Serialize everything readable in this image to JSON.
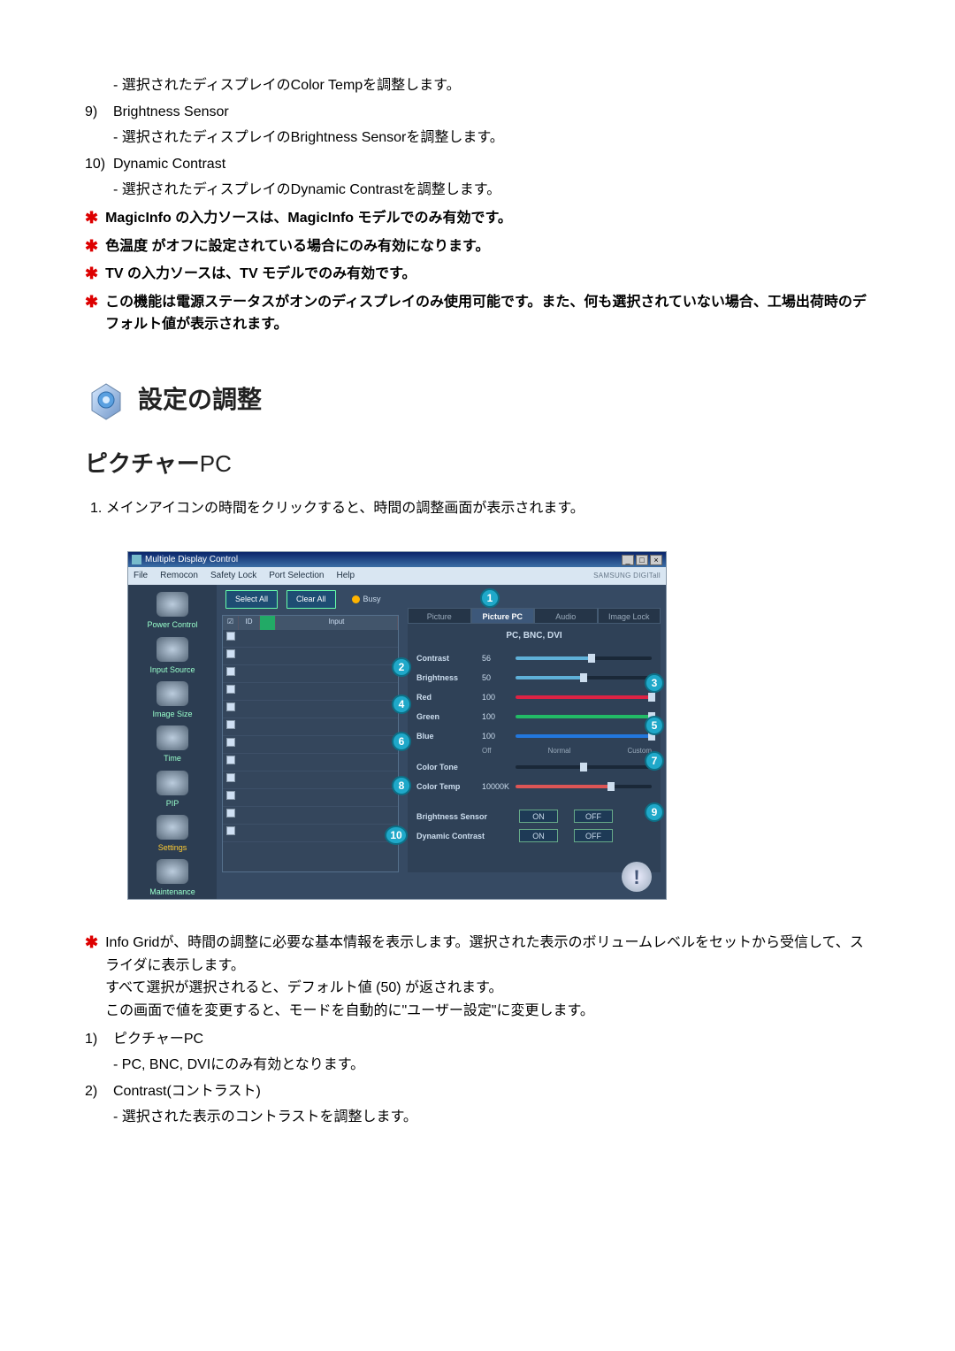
{
  "top_items": [
    {
      "desc": "- 選択されたディスプレイのColor Tempを調整します。"
    },
    {
      "num": "9)",
      "title": "Brightness Sensor",
      "desc": "- 選択されたディスプレイのBrightness Sensorを調整します。"
    },
    {
      "num": "10)",
      "title": "Dynamic Contrast",
      "desc": "- 選択されたディスプレイのDynamic Contrastを調整します。"
    }
  ],
  "top_stars": [
    "MagicInfo の入力ソースは、MagicInfo モデルでのみ有効です。",
    "色温度 がオフに設定されている場合にのみ有効になります。",
    "TV の入力ソースは、TV モデルでのみ有効です。",
    "この機能は電源ステータスがオンのディスプレイのみ使用可能です。また、何も選択されていない場合、工場出荷時のデフォルト値が表示されます。"
  ],
  "section_title": "設定の調整",
  "sub_title_jp": "ピクチャー",
  "sub_title_en": "PC",
  "step1": "1.  メインアイコンの時間をクリックすると、時間の調整画面が表示されます。",
  "shot": {
    "title": "Multiple Display Control",
    "menus": [
      "File",
      "Remocon",
      "Safety Lock",
      "Port Selection",
      "Help"
    ],
    "brand": "SAMSUNG DIGITall",
    "sidebar": [
      "Power Control",
      "Input Source",
      "Image Size",
      "Time",
      "PIP",
      "Settings",
      "Maintenance"
    ],
    "buttons": {
      "select_all": "Select All",
      "clear_all": "Clear All",
      "busy": "Busy"
    },
    "list_head": {
      "chk": "☑",
      "id": "ID",
      "input": "Input"
    },
    "tabs": [
      "Picture",
      "Picture PC",
      "Audio",
      "Image Lock"
    ],
    "source": "PC, BNC, DVI",
    "rows": {
      "contrast": {
        "label": "Contrast",
        "value": "56"
      },
      "brightness": {
        "label": "Brightness",
        "value": "50"
      },
      "red": {
        "label": "Red",
        "value": "100"
      },
      "green": {
        "label": "Green",
        "value": "100"
      },
      "blue": {
        "label": "Blue",
        "value": "100"
      },
      "color_tone": {
        "label": "Color Tone",
        "opts": [
          "Off",
          "Normal",
          "Custom"
        ]
      },
      "color_temp": {
        "label": "Color Temp",
        "value": "10000K"
      },
      "brightness_sensor": {
        "label": "Brightness Sensor",
        "on": "ON",
        "off": "OFF"
      },
      "dynamic_contrast": {
        "label": "Dynamic Contrast",
        "on": "ON",
        "off": "OFF"
      }
    },
    "markers": [
      "1",
      "2",
      "3",
      "4",
      "5",
      "6",
      "7",
      "8",
      "9",
      "10"
    ]
  },
  "bottom_star": {
    "line1": "Info Gridが、時間の調整に必要な基本情報を表示します。選択された表示のボリュームレベルをセットから受信して、スライダに表示します。",
    "line2": "すべて選択が選択されると、デフォルト値 (50) が返されます。",
    "line3": "この画面で値を変更すると、モードを自動的に\"ユーザー設定\"に変更します。"
  },
  "bottom_items": [
    {
      "num": "1)",
      "title": "ピクチャーPC",
      "desc": "- PC, BNC, DVIにのみ有効となります。"
    },
    {
      "num": "2)",
      "title": "Contrast(コントラスト)",
      "desc": "- 選択された表示のコントラストを調整します。"
    }
  ]
}
